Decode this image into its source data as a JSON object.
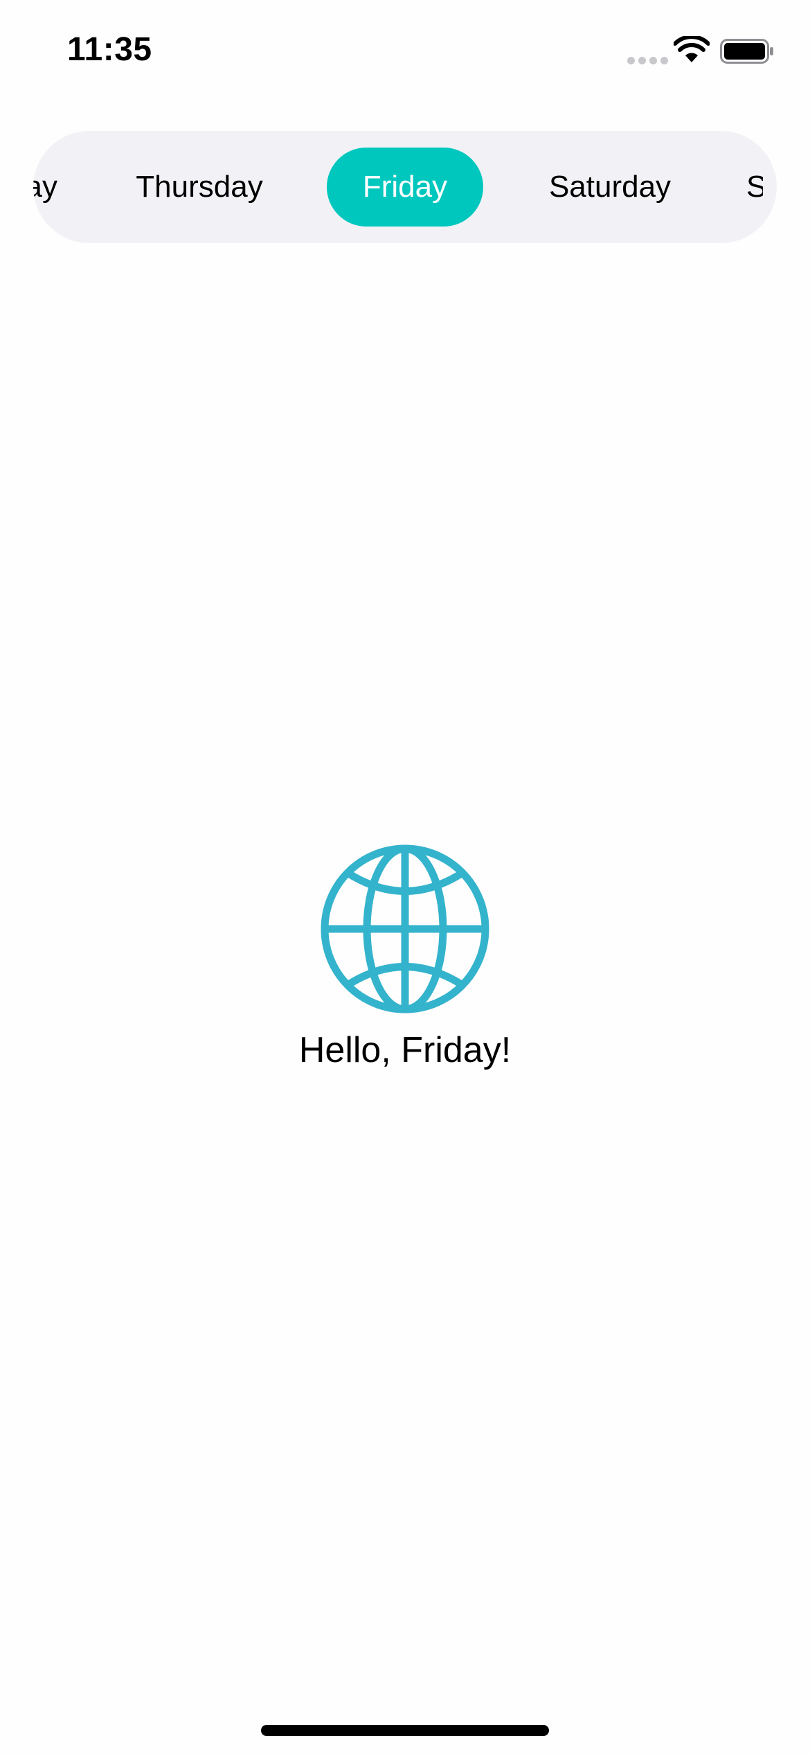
{
  "status_bar": {
    "time": "11:35"
  },
  "day_selector": {
    "days": [
      {
        "label": "Wednesday",
        "state": "partial-left"
      },
      {
        "label": "Thursday",
        "state": "normal"
      },
      {
        "label": "Friday",
        "state": "selected"
      },
      {
        "label": "Saturday",
        "state": "normal"
      },
      {
        "label": "Sunday",
        "state": "partial-right"
      }
    ],
    "selected": "Friday",
    "selected_color": "#00c7be"
  },
  "content": {
    "icon": "globe-icon",
    "icon_color": "#34b3cc",
    "greeting": "Hello, Friday!"
  }
}
